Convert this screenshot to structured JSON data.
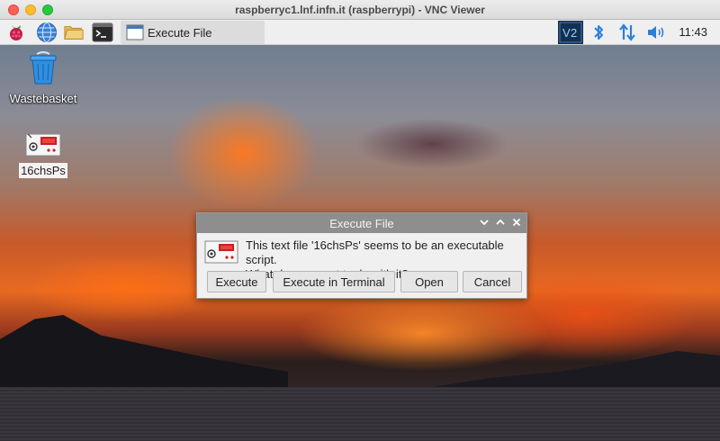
{
  "window": {
    "title": "raspberryc1.lnf.infn.it (raspberrypi) - VNC Viewer"
  },
  "taskbar": {
    "launchers": [
      {
        "icon": "raspberry-menu-icon"
      },
      {
        "icon": "web-browser-icon"
      },
      {
        "icon": "file-manager-icon"
      },
      {
        "icon": "terminal-icon"
      }
    ],
    "tasks": [
      {
        "label": "Execute File",
        "icon": "window-icon"
      }
    ],
    "tray": [
      {
        "icon": "vnc-icon"
      },
      {
        "icon": "bluetooth-icon"
      },
      {
        "icon": "network-icon"
      },
      {
        "icon": "volume-icon"
      }
    ],
    "clock": "11:43"
  },
  "desktop": {
    "icons": [
      {
        "label": "Wastebasket",
        "icon": "wastebasket-icon"
      },
      {
        "label": "16chsPs",
        "icon": "executable-file-icon",
        "selected": true
      }
    ]
  },
  "dialog": {
    "title": "Execute File",
    "message_line1": "This text file '16chsPs' seems to be an executable script.",
    "message_line2": "What do you want to do with it?",
    "buttons": {
      "execute": "Execute",
      "execute_terminal": "Execute in Terminal",
      "open": "Open",
      "cancel": "Cancel"
    }
  },
  "colors": {
    "accent_blue": "#2d7fd8",
    "dialog_title_bg": "#8e8e8e",
    "taskbar_bg": "#efefef"
  }
}
